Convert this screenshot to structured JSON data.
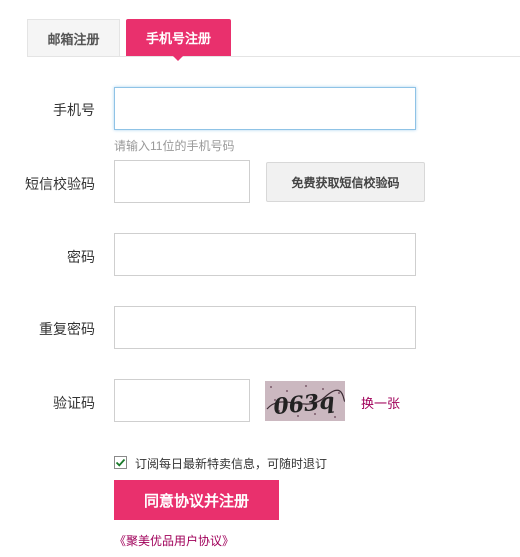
{
  "tabs": {
    "email_label": "邮箱注册",
    "phone_label": "手机号注册"
  },
  "form": {
    "phone_label": "手机号",
    "phone_value": "",
    "phone_hint": "请输入11位的手机号码",
    "sms_label": "短信校验码",
    "sms_value": "",
    "sms_button": "免费获取短信校验码",
    "password_label": "密码",
    "password_value": "",
    "repeat_password_label": "重复密码",
    "repeat_password_value": "",
    "captcha_label": "验证码",
    "captcha_value": "",
    "captcha_text": "063q",
    "refresh_label": "换一张",
    "subscribe_checked": true,
    "subscribe_label": "订阅每日最新特卖信息，可随时退订",
    "submit_label": "同意协议并注册",
    "agreement_link": "《聚美优品用户协议》"
  },
  "colors": {
    "accent": "#e9306d",
    "link": "#a0005a",
    "focus_border": "#8fc3e6"
  }
}
